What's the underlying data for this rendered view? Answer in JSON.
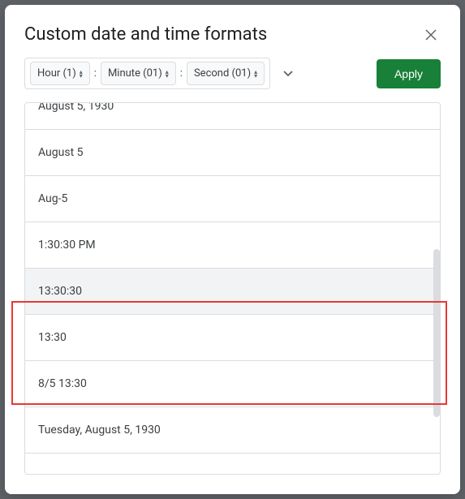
{
  "dialog": {
    "title": "Custom date and time formats"
  },
  "tokens": {
    "hour": "Hour (1)",
    "sep1": ":",
    "minute": "Minute (01)",
    "sep2": ":",
    "second": "Second (01)"
  },
  "buttons": {
    "apply": "Apply"
  },
  "format_list": [
    {
      "label": "August 5, 1930",
      "selected": false
    },
    {
      "label": "August 5",
      "selected": false
    },
    {
      "label": "Aug-5",
      "selected": false
    },
    {
      "label": "1:30:30 PM",
      "selected": false
    },
    {
      "label": "13:30:30",
      "selected": true
    },
    {
      "label": "13:30",
      "selected": false
    },
    {
      "label": "8/5 13:30",
      "selected": false
    },
    {
      "label": "Tuesday, August 5, 1930",
      "selected": false
    }
  ]
}
